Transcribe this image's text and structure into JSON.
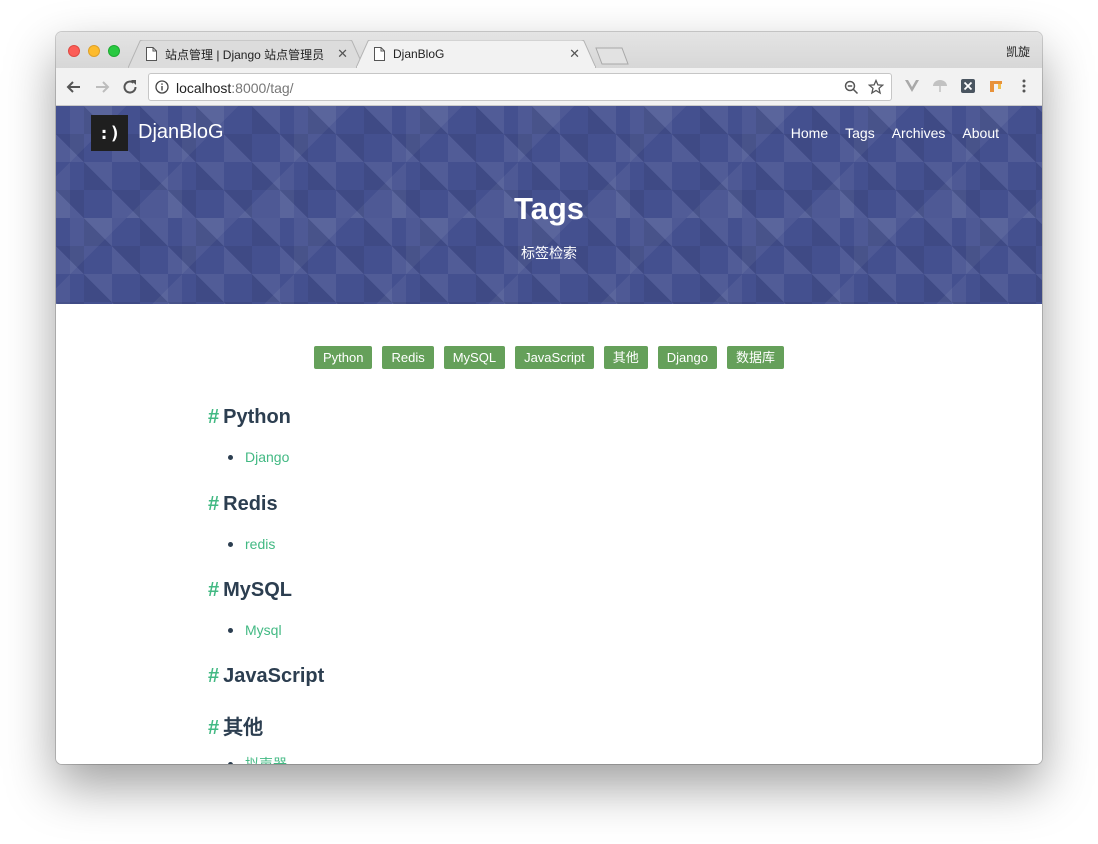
{
  "browser": {
    "tabs": [
      {
        "title": "站点管理 | Django 站点管理员",
        "active": false
      },
      {
        "title": "DjanBloG",
        "active": true
      }
    ],
    "profile_name": "凯旋",
    "url_host": "localhost",
    "url_rest": ":8000/tag/"
  },
  "site": {
    "logo_text": ":)",
    "brand": "DjanBloG",
    "nav": [
      "Home",
      "Tags",
      "Archives",
      "About"
    ],
    "hero_title": "Tags",
    "hero_subtitle": "标签检索"
  },
  "tag_cloud": [
    "Python",
    "Redis",
    "MySQL",
    "JavaScript",
    "其他",
    "Django",
    "数据库"
  ],
  "tag_sections": [
    {
      "name": "Python",
      "posts": [
        "Django"
      ]
    },
    {
      "name": "Redis",
      "posts": [
        "redis"
      ]
    },
    {
      "name": "MySQL",
      "posts": [
        "Mysql"
      ]
    },
    {
      "name": "JavaScript",
      "posts": []
    },
    {
      "name": "其他",
      "posts": [
        "拟声器"
      ]
    }
  ],
  "colors": {
    "hero_bg": "#44508f",
    "tag_button": "#65a05a",
    "link": "#42b983",
    "heading": "#2c3e50"
  }
}
